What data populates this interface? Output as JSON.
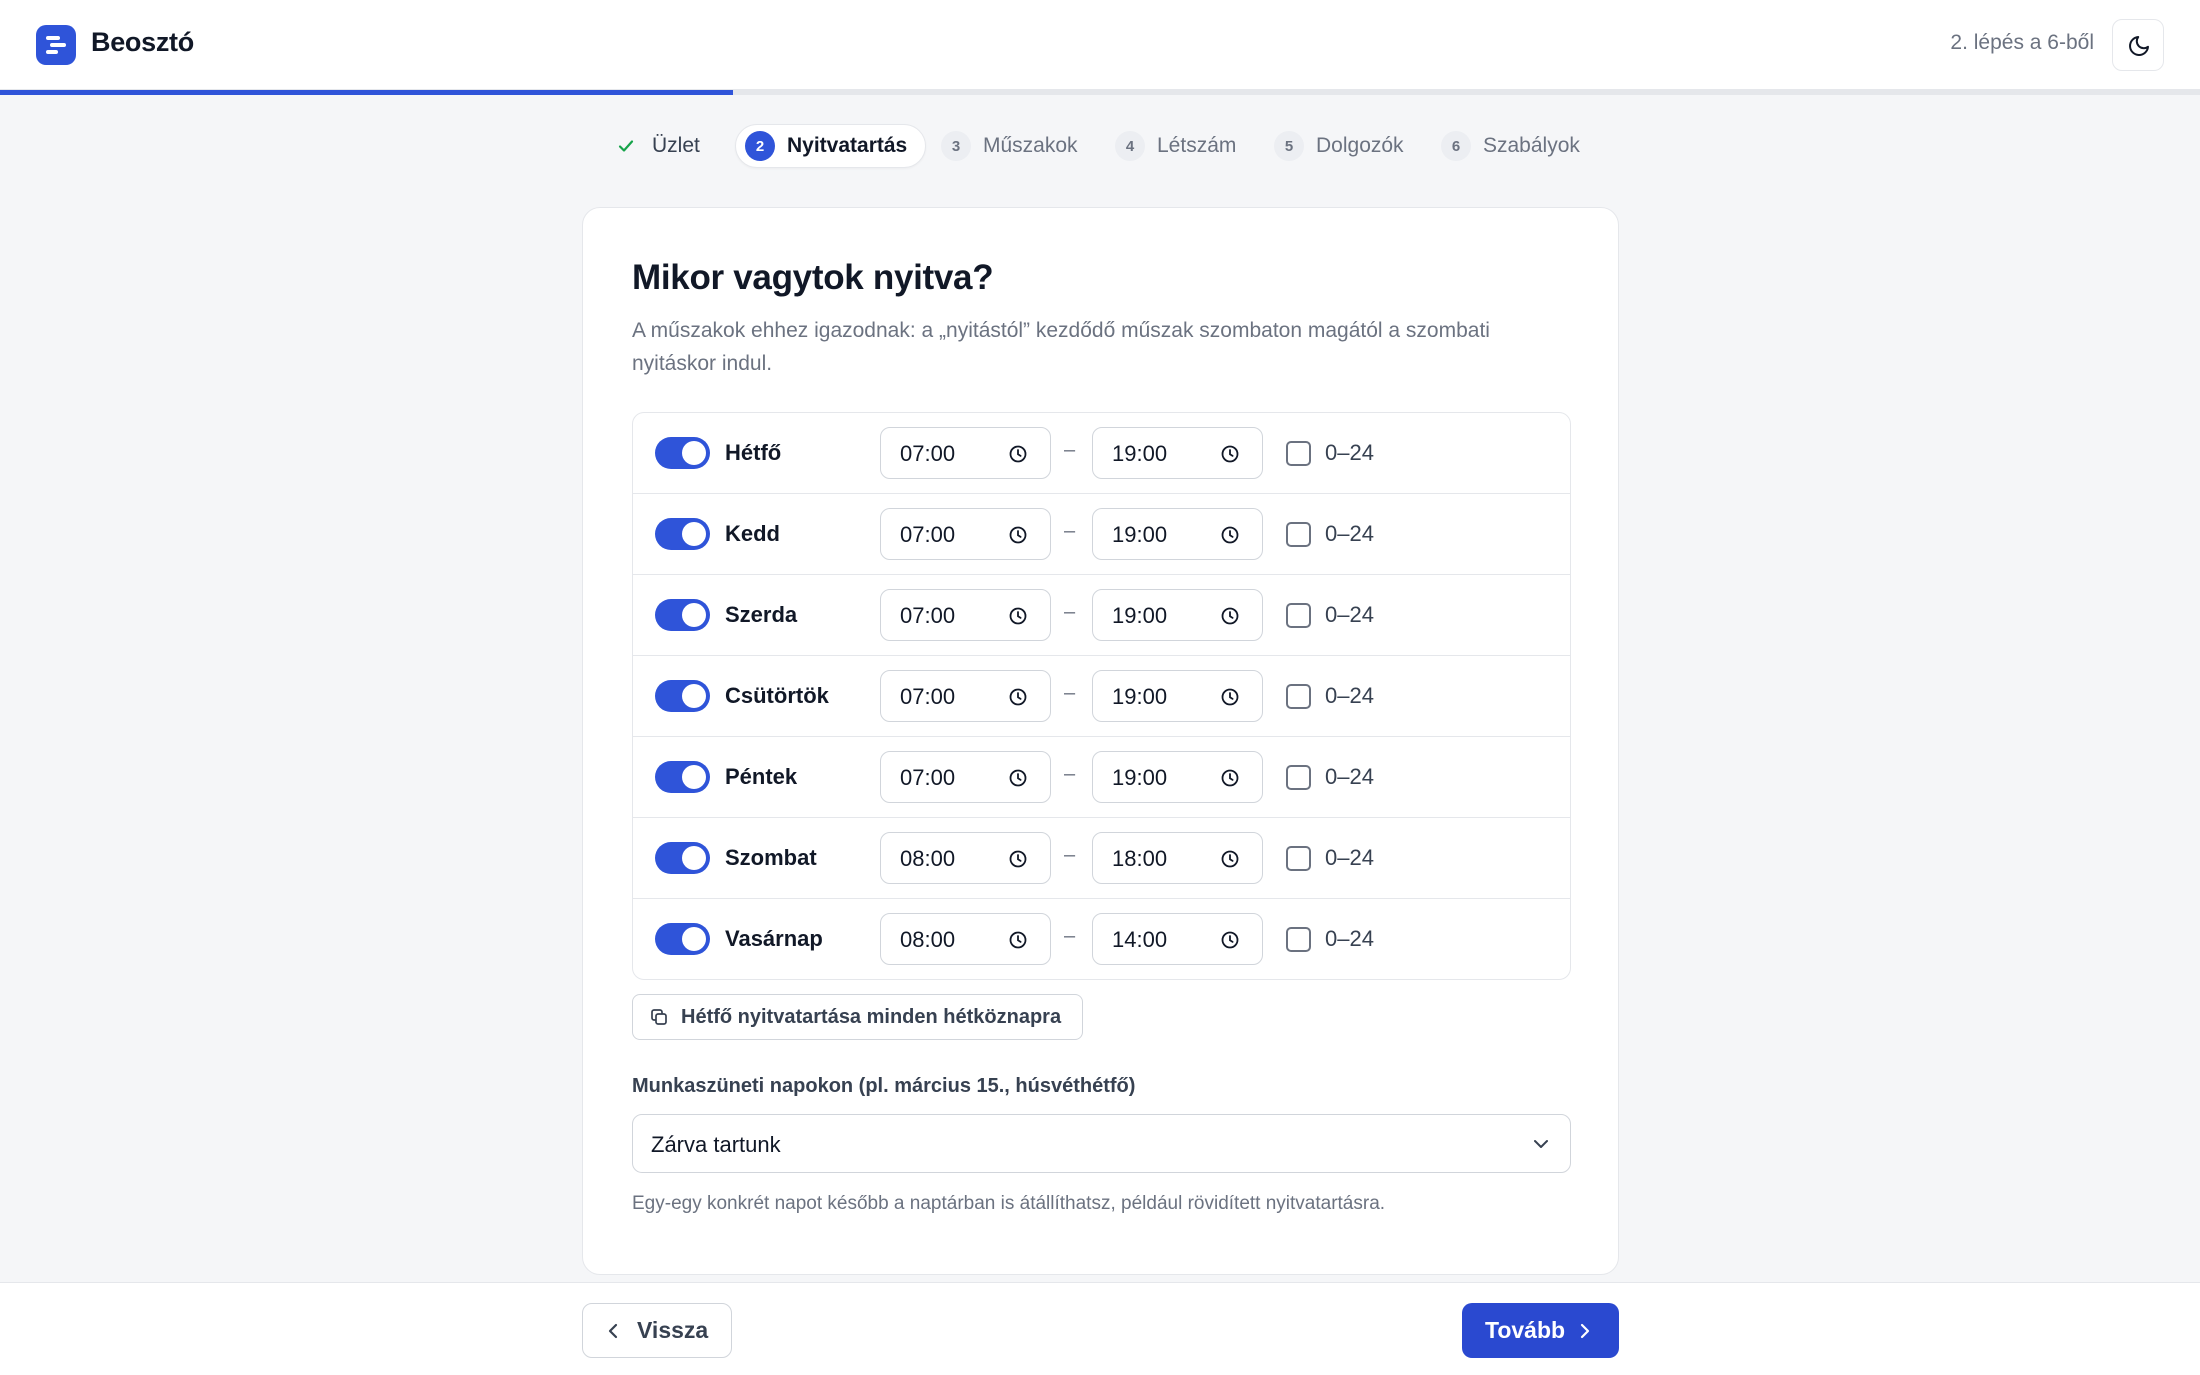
{
  "header": {
    "brand": "Beosztó",
    "step_counter": "2. lépés a 6-ből",
    "progress_fraction": 0.333,
    "theme_icon": "moon-icon"
  },
  "steps": [
    {
      "label": "Üzlet",
      "state": "done"
    },
    {
      "num": "2",
      "label": "Nyitvatartás",
      "state": "active"
    },
    {
      "num": "3",
      "label": "Műszakok",
      "state": "upcoming"
    },
    {
      "num": "4",
      "label": "Létszám",
      "state": "upcoming"
    },
    {
      "num": "5",
      "label": "Dolgozók",
      "state": "upcoming"
    },
    {
      "num": "6",
      "label": "Szabályok",
      "state": "upcoming"
    }
  ],
  "card": {
    "title": "Mikor vagytok nyitva?",
    "description": "A műszakok ehhez igazodnak: a „nyitástól” kezdődő műszak szombaton magától a szombati nyitáskor indul."
  },
  "days": [
    {
      "name": "Hétfő",
      "enabled": true,
      "open": "07:00",
      "close": "19:00",
      "allday_label": "0–24",
      "allday": false
    },
    {
      "name": "Kedd",
      "enabled": true,
      "open": "07:00",
      "close": "19:00",
      "allday_label": "0–24",
      "allday": false
    },
    {
      "name": "Szerda",
      "enabled": true,
      "open": "07:00",
      "close": "19:00",
      "allday_label": "0–24",
      "allday": false
    },
    {
      "name": "Csütörtök",
      "enabled": true,
      "open": "07:00",
      "close": "19:00",
      "allday_label": "0–24",
      "allday": false
    },
    {
      "name": "Péntek",
      "enabled": true,
      "open": "07:00",
      "close": "19:00",
      "allday_label": "0–24",
      "allday": false
    },
    {
      "name": "Szombat",
      "enabled": true,
      "open": "08:00",
      "close": "18:00",
      "allday_label": "0–24",
      "allday": false
    },
    {
      "name": "Vasárnap",
      "enabled": true,
      "open": "08:00",
      "close": "14:00",
      "allday_label": "0–24",
      "allday": false
    }
  ],
  "range_separator": "–",
  "copy_button": "Hétfő nyitvatartása minden hétköznapra",
  "holiday": {
    "label": "Munkaszüneti napokon (pl. március 15., húsvéthétfő)",
    "selected": "Zárva tartunk",
    "help": "Egy-egy konkrét napot később a naptárban is átállíthatsz, például rövidített nyitvatartásra."
  },
  "footer": {
    "back_label": "Vissza",
    "next_label": "Tovább"
  },
  "colors": {
    "accent": "#2f54d9",
    "success": "#16a34a",
    "background": "#f5f6f8"
  }
}
